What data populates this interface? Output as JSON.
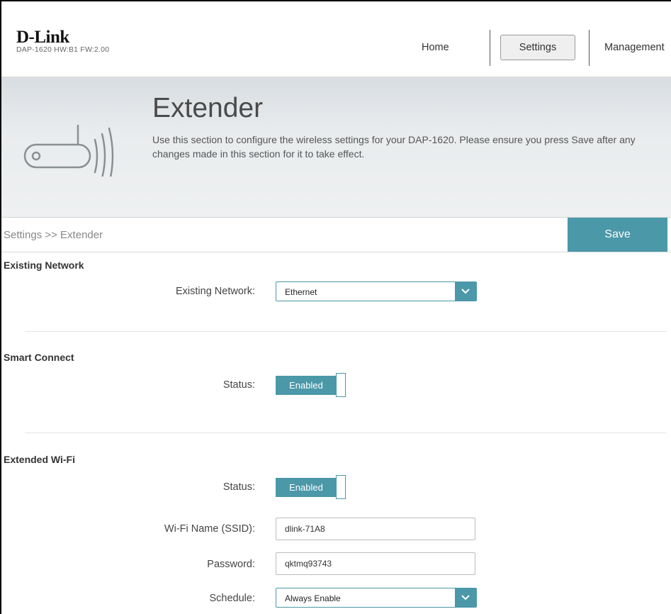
{
  "header": {
    "logo_text": "D-Link",
    "device_info": "DAP-1620  HW:B1  FW:2.00",
    "nav": {
      "home": "Home",
      "settings": "Settings",
      "management": "Management"
    }
  },
  "banner": {
    "title": "Extender",
    "description": "Use this section to configure the wireless settings for your DAP-1620. Please ensure you press Save after any changes made in this section for it to take effect."
  },
  "breadcrumb": "Settings >> Extender",
  "save_label": "Save",
  "existing_network": {
    "section_title": "Existing Network",
    "label": "Existing Network:",
    "value": "Ethernet"
  },
  "smart_connect": {
    "section_title": "Smart Connect",
    "status_label": "Status:",
    "status_value": "Enabled"
  },
  "extended_wifi": {
    "section_title": "Extended Wi-Fi",
    "status_label": "Status:",
    "status_value": "Enabled",
    "ssid_label": "Wi-Fi Name (SSID):",
    "ssid_value": "dlink-71A8",
    "password_label": "Password:",
    "password_value": "qktmq93743",
    "schedule_label": "Schedule:",
    "schedule_value": "Always Enable"
  },
  "colors": {
    "accent": "#4b98a9"
  }
}
